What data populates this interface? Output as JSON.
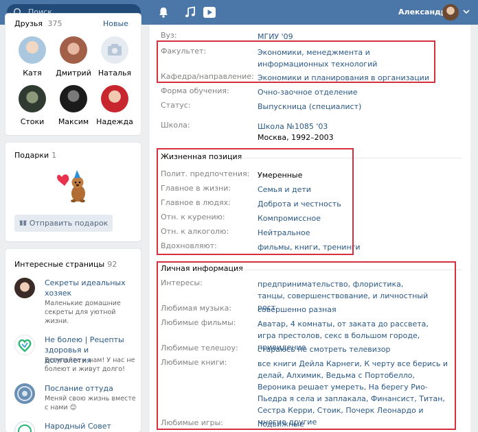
{
  "header": {
    "search_placeholder": "Поиск",
    "user_name": "Александр",
    "icons": [
      "search-icon",
      "bell-icon",
      "music-icon",
      "video-icon",
      "chevron-down-icon"
    ]
  },
  "friends": {
    "title": "Друзья",
    "count": "375",
    "link": "Новые",
    "items": [
      "Катя",
      "Дмитрий",
      "Наталья",
      "Стоки",
      "Максим",
      "Надежда"
    ]
  },
  "gifts": {
    "title": "Подарки",
    "count": "1",
    "button": "Отправить подарок"
  },
  "pages": {
    "title": "Интересные страницы",
    "count": "92",
    "items": [
      {
        "name": "Секреты идеальных хозяек",
        "desc": "Маленькие домашние секреты для уютной жизни."
      },
      {
        "name": "Не болею | Рецепты здоровья и долголетия",
        "desc": "Вступайте к нам! У нас не болеют и живут долго!"
      },
      {
        "name": "Послание оттуда",
        "desc": "Меняй свою жизнь вместе с нами 😊"
      },
      {
        "name": "Народный Совет района",
        "desc": ""
      }
    ]
  },
  "education": {
    "rows": [
      {
        "label": "Вуз:",
        "value": "МГИУ '09"
      },
      {
        "label": "Факультет:",
        "value": "Экономики, менеджмента и информационных технологий"
      },
      {
        "label": "Кафедра/направление:",
        "value": "Экономики и планирования в организации"
      },
      {
        "label": "Форма обучения:",
        "value": "Очно-заочное отделение"
      },
      {
        "label": "Статус:",
        "value": "Выпускница (специалист)"
      },
      {
        "label": "Школа:",
        "value": "Школа №1085 '03",
        "extra": "Москва, 1992–2003"
      }
    ]
  },
  "life_position": {
    "title": "Жизненная позиция",
    "rows": [
      {
        "label": "Полит. предпочтения:",
        "value": "Умеренные"
      },
      {
        "label": "Главное в жизни:",
        "value": "Семья и дети"
      },
      {
        "label": "Главное в людях:",
        "value": "Доброта и честность"
      },
      {
        "label": "Отн. к курению:",
        "value": "Компромиссное"
      },
      {
        "label": "Отн. к алкоголю:",
        "value": "Нейтральное"
      },
      {
        "label": "Вдохновляют:",
        "value": "фильмы, книги, тренинги"
      }
    ]
  },
  "personal": {
    "title": "Личная информация",
    "rows": [
      {
        "label": "Интересы:",
        "value": "предпринимательство, флористика, танцы, совершенствование, и личностный рост"
      },
      {
        "label": "Любимая музыка:",
        "value": "совершенно разная"
      },
      {
        "label": "Любимые фильмы:",
        "value": "Аватар, 4 комнаты, от заката до рассвета, игра престолов, секс в большом городе, привидение"
      },
      {
        "label": "Любимые телешоу:",
        "value": "стараюсь не смотреть телевизор"
      },
      {
        "label": "Любимые книги:",
        "value": "все книги Дейла Карнеги, К черту все берись и делай, Алхимик, Ведьма с Портобелло, Вероника решает умереть, На берегу Рио-Пьедра я села и заплакала, Финансист, Титан, Сестра Керри, Стоик, Почерк Леонардо и многие другие"
      },
      {
        "label": "Любимые игры:",
        "value": "подвижные"
      }
    ]
  },
  "colors": {
    "header": "#4a76a8",
    "link": "#2a5885",
    "label": "#828282",
    "highlight": "#d52e3d"
  }
}
